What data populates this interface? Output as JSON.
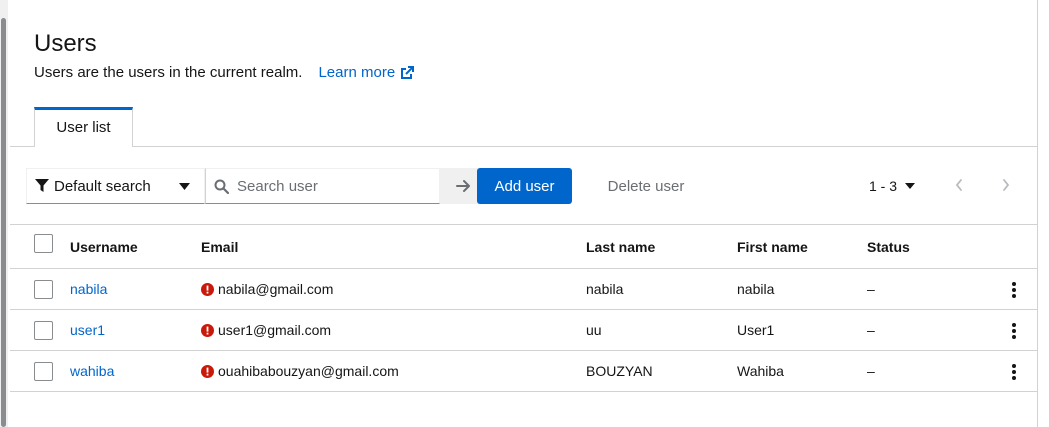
{
  "header": {
    "title": "Users",
    "subtitle": "Users are the users in the current realm.",
    "learn_more": "Learn more"
  },
  "tabs": [
    {
      "label": "User list"
    }
  ],
  "toolbar": {
    "filter_label": "Default search",
    "search_placeholder": "Search user",
    "add_user_label": "Add user",
    "delete_user_label": "Delete user",
    "pagination_label": "1 - 3"
  },
  "table": {
    "columns": [
      "Username",
      "Email",
      "Last name",
      "First name",
      "Status"
    ],
    "rows": [
      {
        "username": "nabila",
        "email": "nabila@gmail.com",
        "last_name": "nabila",
        "first_name": "nabila",
        "status": "–"
      },
      {
        "username": "user1",
        "email": "user1@gmail.com",
        "last_name": "uu",
        "first_name": "User1",
        "status": "–"
      },
      {
        "username": "wahiba",
        "email": "ouahibabouzyan@gmail.com",
        "last_name": "BOUZYAN",
        "first_name": "Wahiba",
        "status": "–"
      }
    ]
  },
  "icons": {
    "filter": "filter-icon",
    "search": "search-icon",
    "arrow": "arrow-right-icon",
    "external": "external-link-icon",
    "error": "exclamation-circle-icon",
    "kebab": "kebab-menu-icon"
  },
  "colors": {
    "accent": "#0066cc",
    "error": "#c9190b",
    "text": "#151515",
    "muted": "#6a6e73"
  }
}
